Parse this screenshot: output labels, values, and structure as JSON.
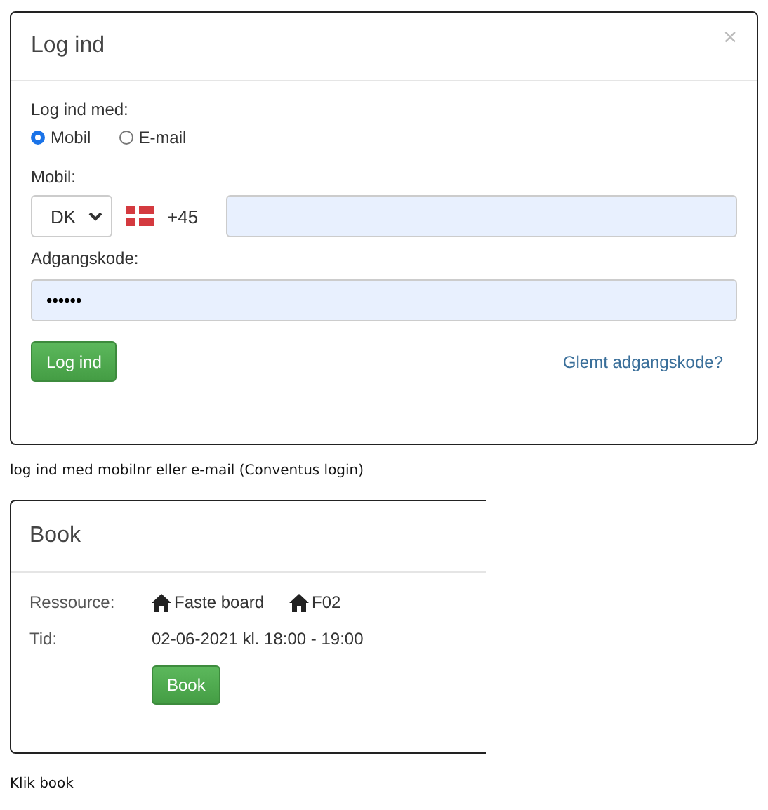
{
  "login_dialog": {
    "title": "Log ind",
    "close": "×",
    "method_label": "Log ind med:",
    "methods": [
      {
        "label": "Mobil",
        "selected": true
      },
      {
        "label": "E-mail",
        "selected": false
      }
    ],
    "mobile_label": "Mobil:",
    "country": "DK",
    "dial_code": "+45",
    "password_label": "Adgangskode:",
    "password_value": "••••••",
    "submit": "Log ind",
    "forgot_link": "Glemt adgangskode?"
  },
  "caption_1": "log ind med mobilnr eller e-mail (Conventus login)",
  "book_panel": {
    "title": "Book",
    "resource_label": "Ressource:",
    "resources": [
      "Faste board",
      "F02"
    ],
    "time_label": "Tid:",
    "time_value": "02-06-2021 kl. 18:00 - 19:00",
    "submit": "Book"
  },
  "caption_2": "Klik book"
}
